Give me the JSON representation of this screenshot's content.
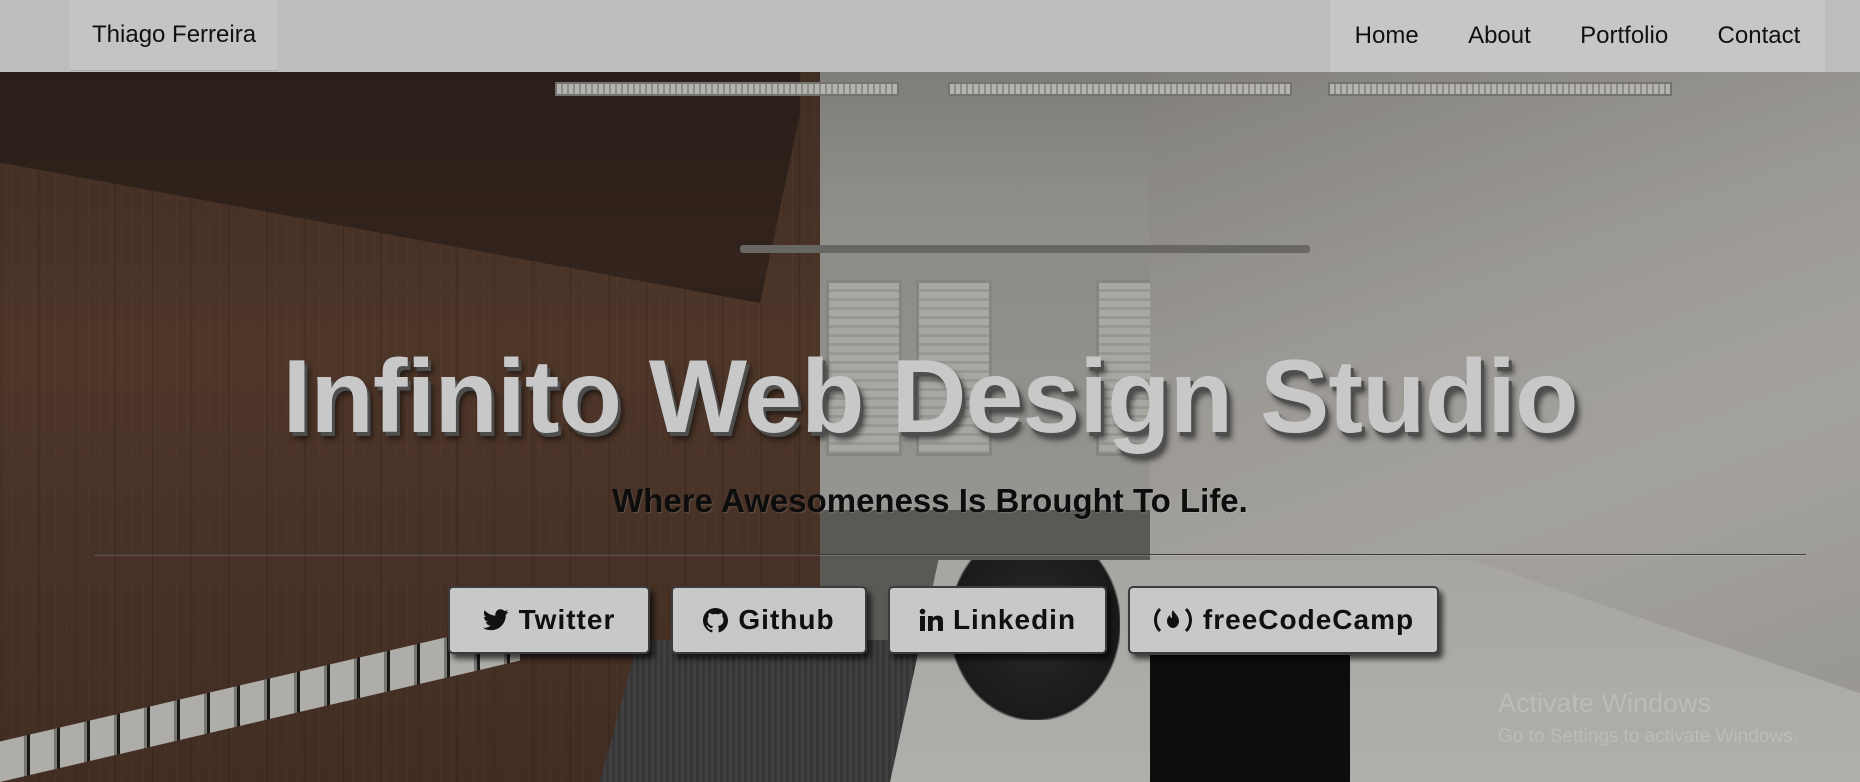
{
  "navbar": {
    "brand": "Thiago Ferreira",
    "links": [
      "Home",
      "About",
      "Portfolio",
      "Contact"
    ]
  },
  "hero": {
    "title": "Infinito Web Design Studio",
    "subtitle": "Where Awesomeness Is Brought To Life."
  },
  "social_buttons": [
    {
      "label": "Twitter",
      "icon": "twitter-icon"
    },
    {
      "label": "Github",
      "icon": "github-icon"
    },
    {
      "label": "Linkedin",
      "icon": "linkedin-icon"
    },
    {
      "label": "freeCodeCamp",
      "icon": "freecodecamp-icon"
    }
  ],
  "watermark": {
    "line1": "Activate Windows",
    "line2": "Go to Settings to activate Windows."
  },
  "colors": {
    "navbar_bg": "#bdbdbd",
    "title_text": "#c8c8c8",
    "button_bg": "#c8c8c8"
  }
}
